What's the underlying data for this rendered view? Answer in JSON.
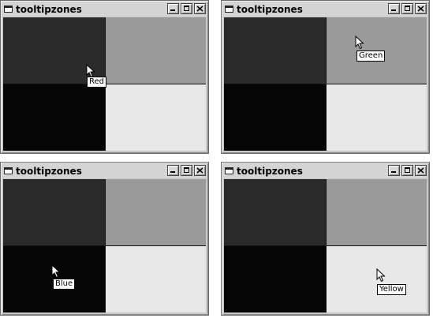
{
  "colors": {
    "zone_red": "#2a2a2a",
    "zone_green": "#9a9a9a",
    "zone_blue": "#050505",
    "zone_yellow": "#e8e8e8",
    "divider": "#111111"
  },
  "windows": [
    {
      "title": "tooltipzones",
      "tooltip": "Red"
    },
    {
      "title": "tooltipzones",
      "tooltip": "Green"
    },
    {
      "title": "tooltipzones",
      "tooltip": "Blue"
    },
    {
      "title": "tooltipzones",
      "tooltip": "Yellow"
    }
  ],
  "icons": {
    "app": "app-window-icon",
    "minimize": "minimize-icon",
    "maximize": "maximize-icon",
    "close": "close-icon",
    "cursor": "mouse-pointer-icon"
  }
}
